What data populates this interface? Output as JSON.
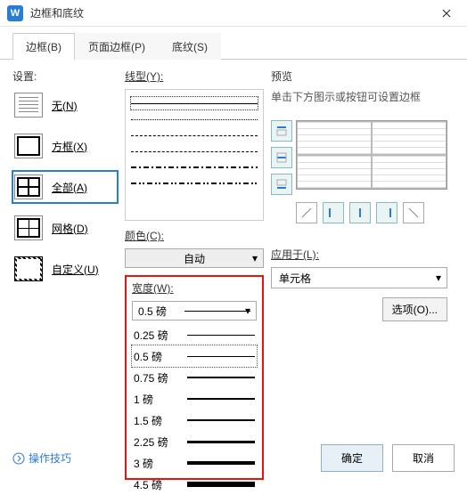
{
  "title": "边框和底纹",
  "tabs": {
    "border": "边框(B)",
    "page": "页面边框(P)",
    "shading": "底纹(S)"
  },
  "settings": {
    "label": "设置:",
    "none": "无(N)",
    "box": "方框(X)",
    "all": "全部(A)",
    "grid": "网格(D)",
    "custom": "自定义(U)"
  },
  "style": {
    "label": "线型(Y):"
  },
  "color": {
    "label": "颜色(C):",
    "value": "自动"
  },
  "width": {
    "label": "宽度(W):",
    "selected": "0.5  磅",
    "options": [
      {
        "label": "0.25 磅",
        "h": 0.5
      },
      {
        "label": "0.5  磅",
        "h": 1
      },
      {
        "label": "0.75 磅",
        "h": 1.2
      },
      {
        "label": "1    磅",
        "h": 1.5
      },
      {
        "label": "1.5  磅",
        "h": 2
      },
      {
        "label": "2.25 磅",
        "h": 3
      },
      {
        "label": "3    磅",
        "h": 4
      },
      {
        "label": "4.5  磅",
        "h": 6
      }
    ]
  },
  "preview": {
    "label": "预览",
    "hint": "单击下方图示或按钮可设置边框"
  },
  "apply": {
    "label": "应用于(L):",
    "value": "单元格"
  },
  "options": "选项(O)...",
  "tips": "操作技巧",
  "ok": "确定",
  "cancel": "取消"
}
